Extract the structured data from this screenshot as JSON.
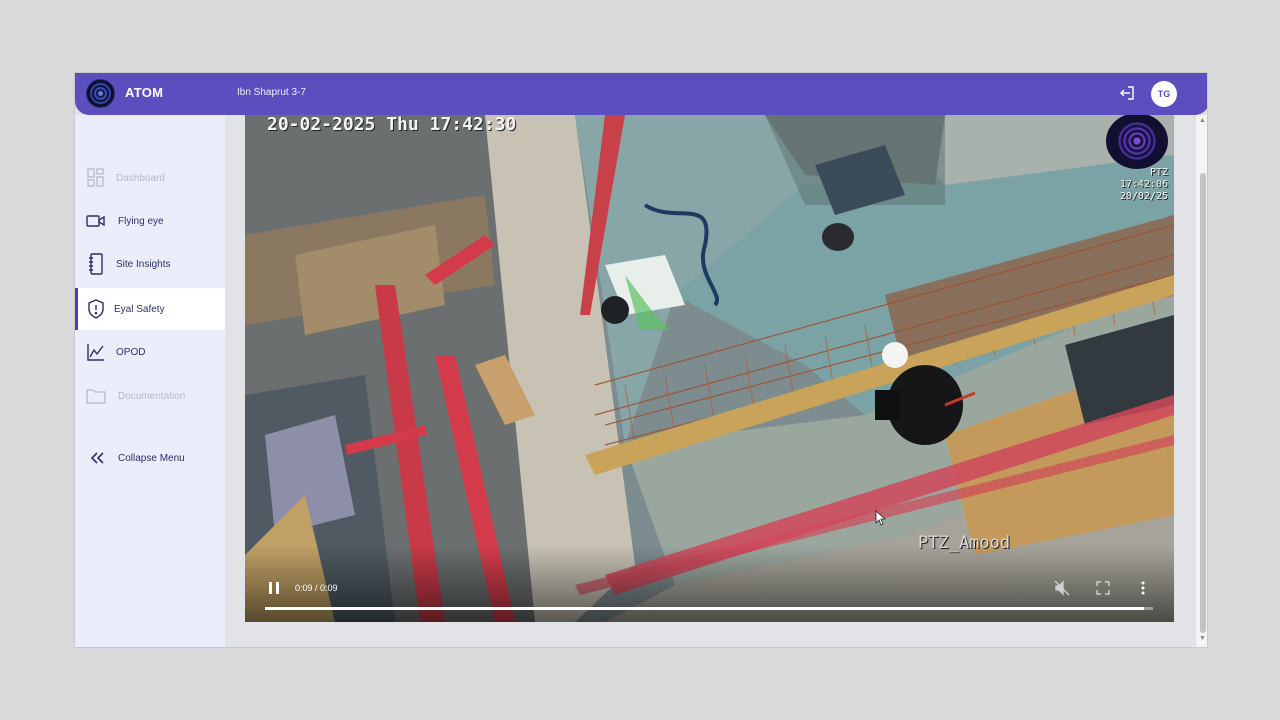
{
  "app": {
    "name": "ATOM",
    "project": "Ibn Shaprut 3-7"
  },
  "header": {
    "user_initials": "TG",
    "logout_icon": "logout-icon"
  },
  "sidebar": {
    "items": [
      {
        "label": "Dashboard",
        "icon": "dashboard-icon",
        "state": "disabled"
      },
      {
        "label": "Flying eye",
        "icon": "video-camera-icon",
        "state": "normal"
      },
      {
        "label": "Site Insights",
        "icon": "notebook-icon",
        "state": "normal"
      },
      {
        "label": "Eyal Safety",
        "icon": "shield-icon",
        "state": "active"
      },
      {
        "label": "OPOD",
        "icon": "line-chart-icon",
        "state": "normal"
      },
      {
        "label": "Documentation",
        "icon": "folder-icon",
        "state": "disabled"
      }
    ],
    "collapse_label": "Collapse Menu"
  },
  "video": {
    "osd_timestamp": "20-02-2025 Thu 17:42:30",
    "osd_ptz_label": "PTZ",
    "osd_ptz_time": "17:42:06",
    "osd_ptz_date": "20/02/25",
    "camera_name": "PTZ_Amood",
    "time_display": "0:09 / 0:09",
    "progress_fraction": 0.99,
    "playing": true,
    "muted": true
  },
  "colors": {
    "accent": "#5b4fc0",
    "sidebar_bg": "#ebedfa",
    "active_item_bg": "#ffffff",
    "page_bg": "#d9d9d9"
  }
}
